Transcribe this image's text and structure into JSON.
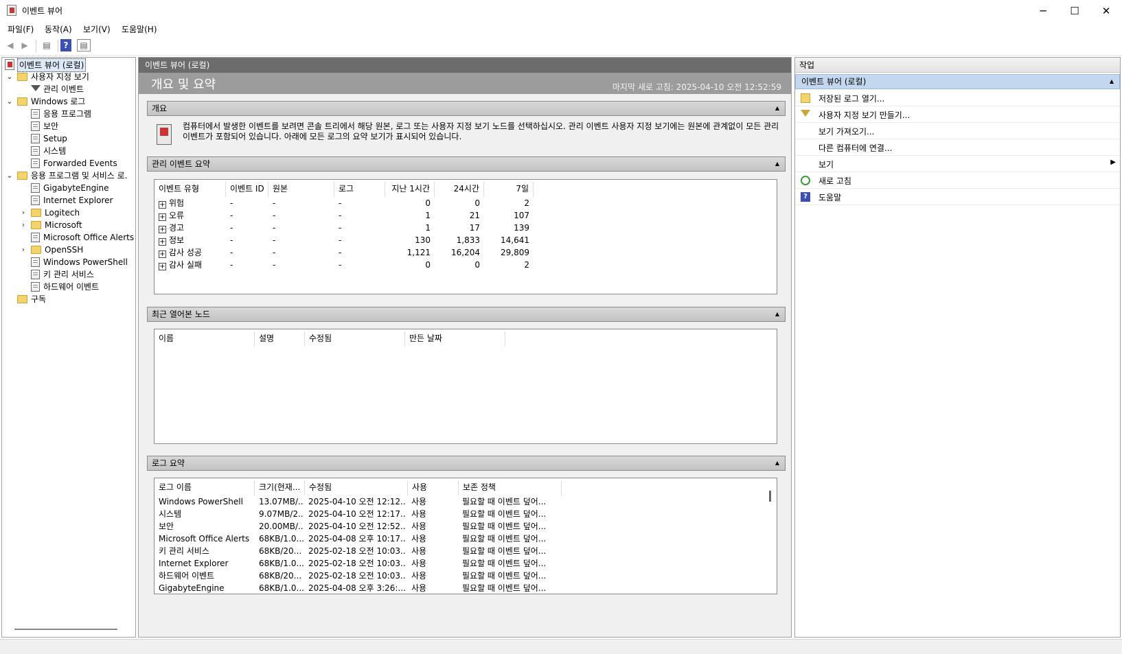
{
  "window": {
    "title": "이벤트 뷰어",
    "min": "─",
    "max": "☐",
    "close": "✕"
  },
  "menu": [
    "파일(F)",
    "동작(A)",
    "보기(V)",
    "도움말(H)"
  ],
  "toolbar": {
    "back": "◀",
    "forward": "▶",
    "pane": "▤",
    "help": "?",
    "view": "▤"
  },
  "tree": {
    "root": "이벤트 뷰어 (로컬)",
    "custom_views": "사용자 지정 보기",
    "admin_events": "관리 이벤트",
    "windows_logs": "Windows 로그",
    "win_items": [
      "응용 프로그램",
      "보안",
      "Setup",
      "시스템",
      "Forwarded Events"
    ],
    "app_services": "응용 프로그램 및 서비스 로.",
    "app_items": [
      "GigabyteEngine",
      "Internet Explorer",
      "Logitech",
      "Microsoft",
      "Microsoft Office Alerts",
      "OpenSSH",
      "Windows PowerShell",
      "키 관리 서비스",
      "하드웨어 이벤트"
    ],
    "subscriptions": "구독"
  },
  "center": {
    "header": "이벤트 뷰어 (로컬)",
    "title": "개요 및 요약",
    "refreshed": "마지막 새로 고침: 2025-04-10 오전 12:52:59",
    "overview_head": "개요",
    "overview_text": "컴퓨터에서 발생한 이벤트를 보려면 콘솔 트리에서 해당 원본, 로그 또는 사용자 지정 보기 노드를 선택하십시오. 관리 이벤트 사용자 지정 보기에는 원본에 관계없이 모든 관리 이벤트가 포함되어 있습니다. 아래에 모든 로그의 요약 보기가 표시되어 있습니다.",
    "admin_head": "관리 이벤트 요약",
    "admin_cols": [
      "이벤트 유형",
      "이벤트 ID",
      "원본",
      "로그",
      "지난 1시간",
      "24시간",
      "7일"
    ],
    "admin_rows": [
      [
        "위험",
        "-",
        "-",
        "-",
        "0",
        "0",
        "2"
      ],
      [
        "오류",
        "-",
        "-",
        "-",
        "1",
        "21",
        "107"
      ],
      [
        "경고",
        "-",
        "-",
        "-",
        "1",
        "17",
        "139"
      ],
      [
        "정보",
        "-",
        "-",
        "-",
        "130",
        "1,833",
        "14,641"
      ],
      [
        "감사 성공",
        "-",
        "-",
        "-",
        "1,121",
        "16,204",
        "29,809"
      ],
      [
        "감사 실패",
        "-",
        "-",
        "-",
        "0",
        "0",
        "2"
      ]
    ],
    "recent_head": "최근 열어본 노드",
    "recent_cols": [
      "이름",
      "설명",
      "수정됨",
      "만든 날짜"
    ],
    "log_head": "로그 요약",
    "log_cols": [
      "로그 이름",
      "크기(현재...",
      "수정됨",
      "사용",
      "보존 정책"
    ],
    "log_rows": [
      [
        "Windows PowerShell",
        "13.07MB/...",
        "2025-04-10 오전 12:12...",
        "사용",
        "필요할 때 이벤트 덮어..."
      ],
      [
        "시스템",
        "9.07MB/2...",
        "2025-04-10 오전 12:17...",
        "사용",
        "필요할 때 이벤트 덮어..."
      ],
      [
        "보안",
        "20.00MB/...",
        "2025-04-10 오전 12:52...",
        "사용",
        "필요할 때 이벤트 덮어..."
      ],
      [
        "Microsoft Office Alerts",
        "68KB/1.0...",
        "2025-04-08 오후 10:17...",
        "사용",
        "필요할 때 이벤트 덮어..."
      ],
      [
        "키 관리 서비스",
        "68KB/20...",
        "2025-02-18 오전 10:03...",
        "사용",
        "필요할 때 이벤트 덮어..."
      ],
      [
        "Internet Explorer",
        "68KB/1.0...",
        "2025-02-18 오전 10:03...",
        "사용",
        "필요할 때 이벤트 덮어..."
      ],
      [
        "하드웨어 이벤트",
        "68KB/20...",
        "2025-02-18 오전 10:03...",
        "사용",
        "필요할 때 이벤트 덮어..."
      ],
      [
        "GigabyteEngine",
        "68KB/1.0...",
        "2025-04-08 오후 3:26:...",
        "사용",
        "필요할 때 이벤트 덮어..."
      ]
    ]
  },
  "actions": {
    "header": "작업",
    "section": "이벤트 뷰어 (로컬)",
    "items": [
      "저장된 로그 열기...",
      "사용자 지정 보기 만들기...",
      "보기 가져오기...",
      "다른 컴퓨터에 연결...",
      "보기",
      "새로 고침",
      "도움말"
    ]
  }
}
